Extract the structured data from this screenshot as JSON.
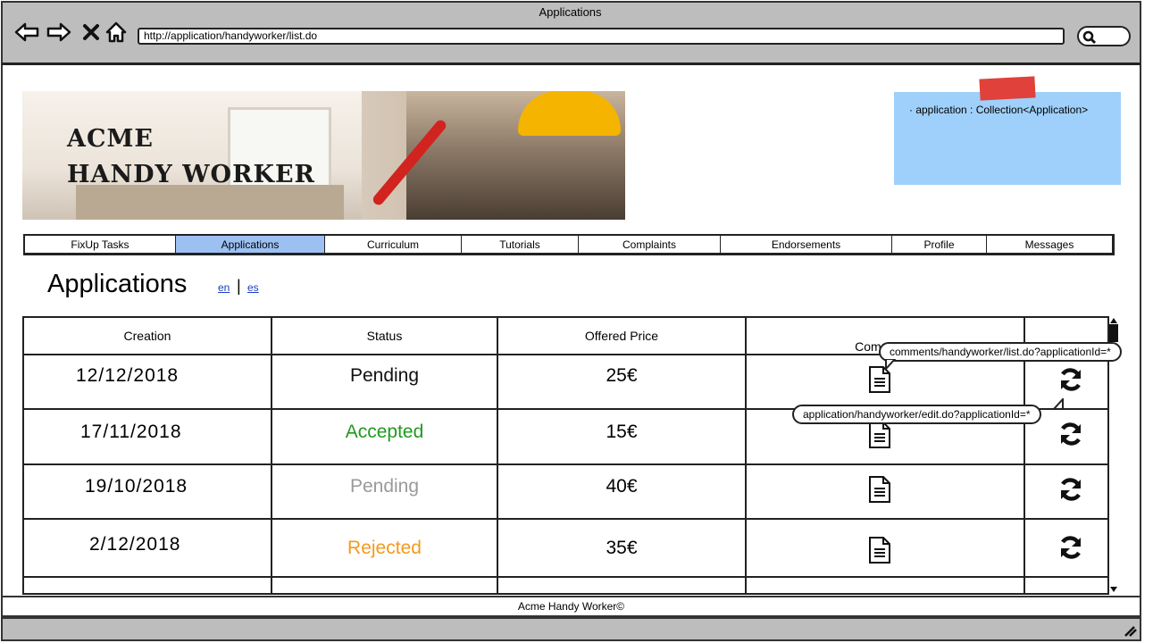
{
  "window": {
    "title": "Applications",
    "url": "http://application/handyworker/list.do"
  },
  "banner": {
    "line1": "ACME",
    "line2": "HANDY WORKER"
  },
  "note": {
    "text": "· application : Collection<Application>"
  },
  "menu": [
    {
      "label": "FixUp Tasks",
      "active": false
    },
    {
      "label": "Applications",
      "active": true
    },
    {
      "label": "Curriculum",
      "active": false
    },
    {
      "label": "Tutorials",
      "active": false
    },
    {
      "label": "Complaints",
      "active": false
    },
    {
      "label": "Endorsements",
      "active": false
    },
    {
      "label": "Profile",
      "active": false
    },
    {
      "label": "Messages",
      "active": false
    }
  ],
  "page": {
    "title": "Applications",
    "lang_en": "en",
    "lang_sep": "|",
    "lang_es": "es"
  },
  "table": {
    "headers": [
      "Creation",
      "Status",
      "Offered Price",
      "Comments"
    ],
    "rows": [
      {
        "creation": "12/12/2018",
        "status": "Pending",
        "status_color": "#111111",
        "price": "25€"
      },
      {
        "creation": "17/11/2018",
        "status": "Accepted",
        "status_color": "#1f9a1f",
        "price": "15€"
      },
      {
        "creation": "19/10/2018",
        "status": "Pending",
        "status_color": "#9a9a9a",
        "price": "40€"
      },
      {
        "creation": "2/12/2018",
        "status": "Rejected",
        "status_color": "#f39a1e",
        "price": "35€"
      }
    ]
  },
  "tooltips": {
    "comments": "comments/handyworker/list.do?applicationId=*",
    "edit": "application/handyworker/edit.do?applicationId=*"
  },
  "footer": {
    "text": "Acme Handy Worker©"
  },
  "icons": {
    "back": "back-arrow-icon",
    "forward": "forward-arrow-icon",
    "close": "close-icon",
    "home": "home-icon",
    "search": "search-icon",
    "comments": "document-icon",
    "edit": "refresh-icon"
  }
}
